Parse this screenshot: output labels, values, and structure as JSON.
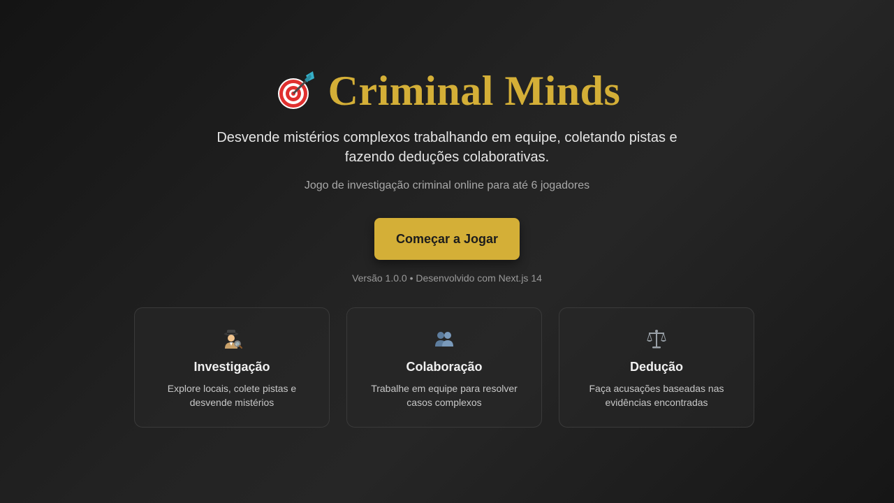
{
  "header": {
    "title": "Criminal Minds",
    "title_icon": "dart-target-icon",
    "subtitle": "Desvende mistérios complexos trabalhando em equipe, coletando pistas e fazendo deduções colaborativas.",
    "tagline": "Jogo de investigação criminal online para até 6 jogadores"
  },
  "actions": {
    "start_label": "Começar a Jogar"
  },
  "footer": {
    "version_text": "Versão 1.0.0 • Desenvolvido com Next.js 14"
  },
  "features": [
    {
      "icon": "detective-icon",
      "title": "Investigação",
      "description": "Explore locais, colete pistas e desvende mistérios"
    },
    {
      "icon": "people-icon",
      "title": "Colaboração",
      "description": "Trabalhe em equipe para resolver casos complexos"
    },
    {
      "icon": "scales-icon",
      "title": "Dedução",
      "description": "Faça acusações baseadas nas evidências encontradas"
    }
  ],
  "colors": {
    "accent": "#d4af37",
    "background": "#1e1e1e",
    "card_border": "#3a3a3a"
  }
}
